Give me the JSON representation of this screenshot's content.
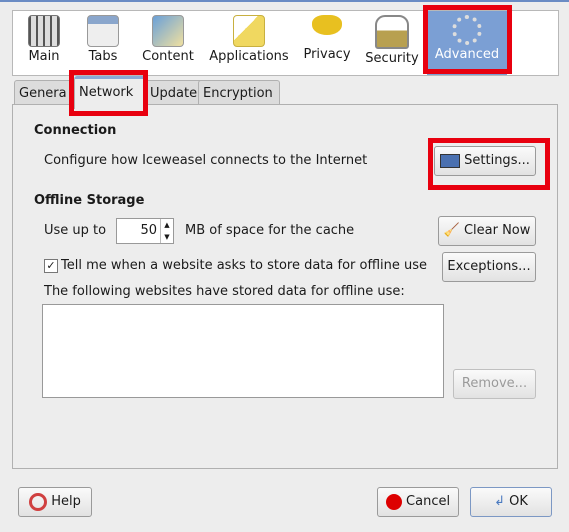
{
  "toolbar": {
    "items": [
      {
        "label": "Main",
        "icon": "sliders-icon"
      },
      {
        "label": "Tabs",
        "icon": "tabs-window-icon"
      },
      {
        "label": "Content",
        "icon": "content-document-icon"
      },
      {
        "label": "Applications",
        "icon": "applications-icon"
      },
      {
        "label": "Privacy",
        "icon": "mask-icon"
      },
      {
        "label": "Security",
        "icon": "padlock-icon"
      },
      {
        "label": "Advanced",
        "icon": "gear-icon",
        "selected": true
      }
    ]
  },
  "tabs": [
    {
      "label": "Genera"
    },
    {
      "label": "Network",
      "active": true
    },
    {
      "label": "Update"
    },
    {
      "label": "Encryption"
    }
  ],
  "connection": {
    "heading": "Connection",
    "description": "Configure how Iceweasel connects to the Internet",
    "settings_label": "Settings..."
  },
  "offline": {
    "heading": "Offline Storage",
    "use_up_to": "Use up to",
    "cache_value": "50",
    "cache_suffix": "MB of space for the cache",
    "clear_now": "Clear Now",
    "tell_me": "Tell me when a website asks to store data for offline use",
    "tell_me_checked": true,
    "exceptions": "Exceptions...",
    "list_label": "The following websites have stored data for offline use:",
    "remove": "Remove..."
  },
  "footer": {
    "help": "Help",
    "cancel": "Cancel",
    "ok": "OK"
  },
  "colors": {
    "highlight": "#e8000f",
    "selected": "#7b9fd4"
  }
}
